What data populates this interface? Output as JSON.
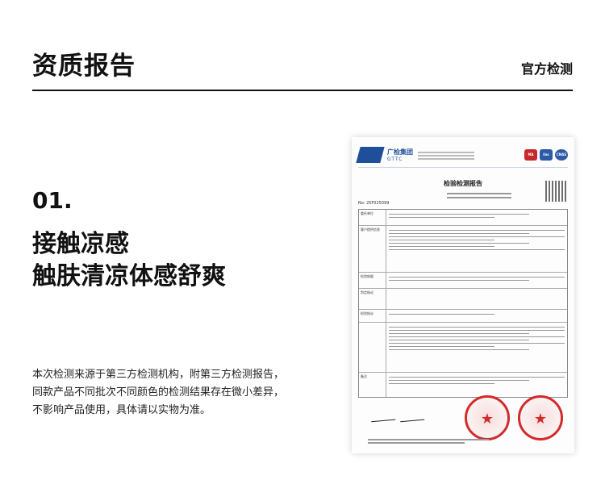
{
  "header": {
    "title": "资质报告",
    "tag": "官方检测"
  },
  "section": {
    "number": "01.",
    "headline_line1": "接触凉感",
    "headline_line2": "触肤清凉体感舒爽",
    "description_line1": "本次检测来源于第三方检测机构，附第三方检测报告，",
    "description_line2": "同款产品不同批次不同颜色的检测结果存在微小差异，",
    "description_line3": "不影响产品使用，具体请以实物为准。"
  },
  "certificate": {
    "org_cn": "广检集团",
    "org_en": "GTTC",
    "title": "检验检测报告",
    "report_no": "No: 25F025099",
    "badges": [
      "MA",
      "ilac",
      "CNAS"
    ],
    "row_labels": [
      "委托单位",
      "客户提供信息",
      "检验依据",
      "判定结论",
      "检验结论",
      "备注"
    ],
    "accent_color": "#1f4f9b",
    "stamp_color": "#d42a2a"
  }
}
